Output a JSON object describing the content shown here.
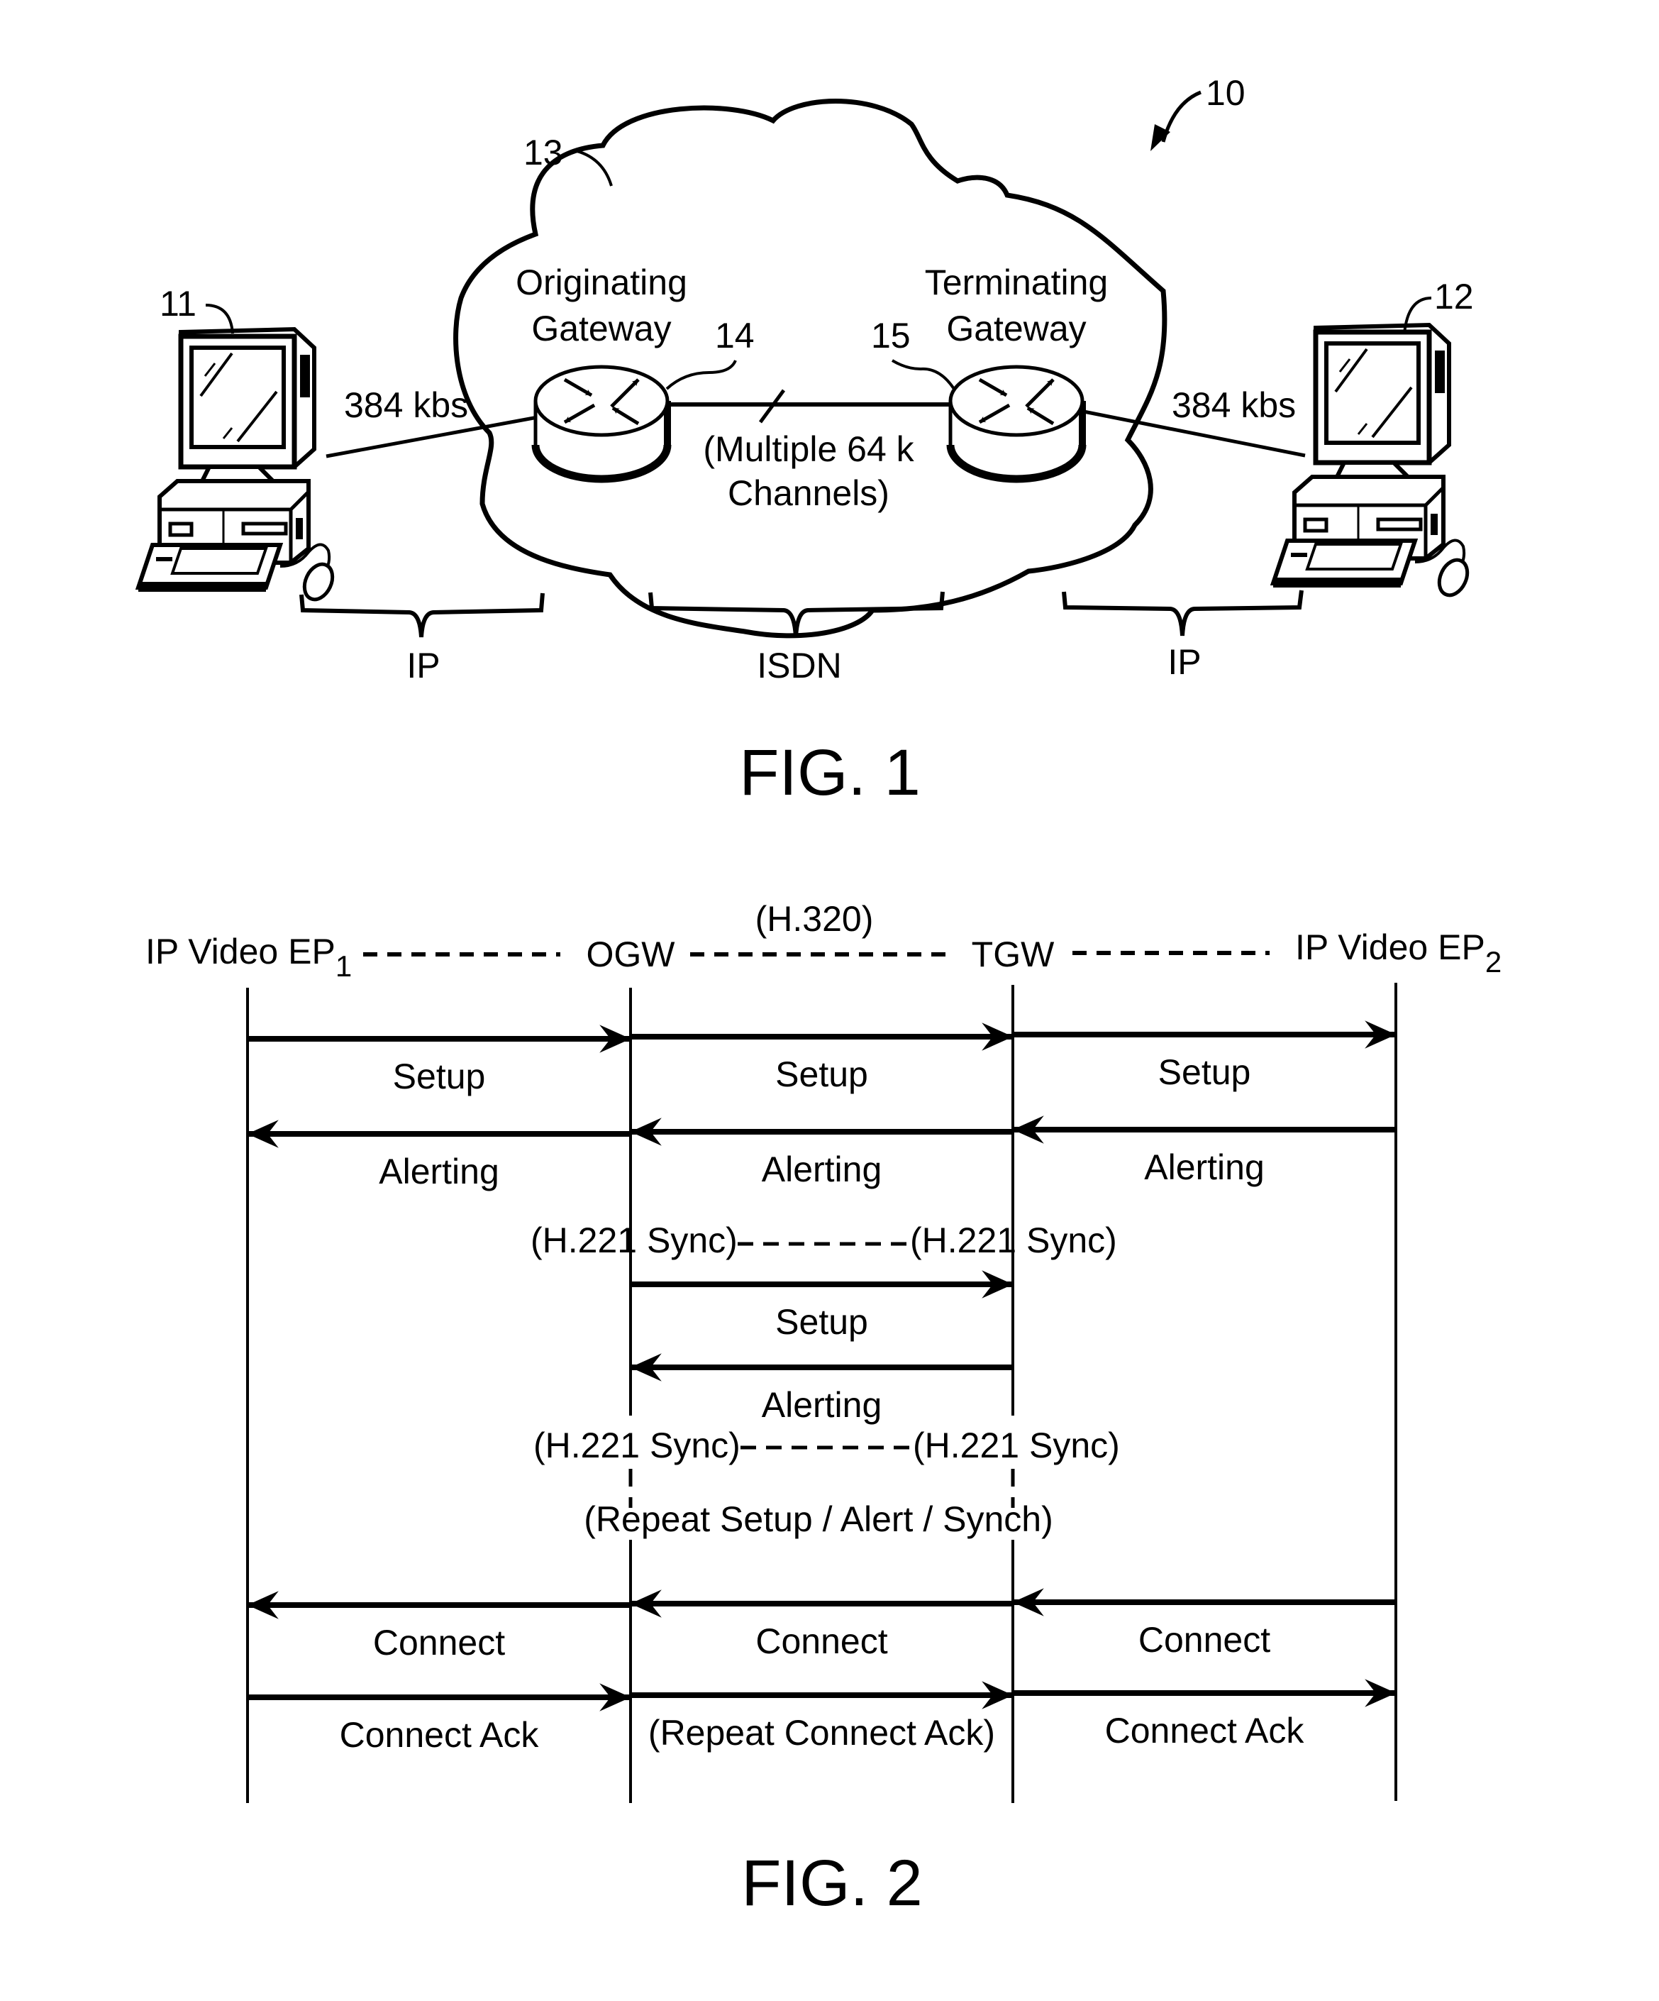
{
  "fig1": {
    "system_ref": "10",
    "cloud_ref": "13",
    "endpoint_left": {
      "ref": "11",
      "rate": "384 kbs"
    },
    "endpoint_right": {
      "ref": "12",
      "rate": "384 kbs"
    },
    "gateway_originating": {
      "line1": "Originating",
      "line2": "Gateway",
      "ref": "14"
    },
    "gateway_terminating": {
      "line1": "Terminating",
      "line2": "Gateway",
      "ref": "15"
    },
    "isdn_link": {
      "line1": "(Multiple 64 k",
      "line2": "Channels)"
    },
    "segments": [
      {
        "label": "IP"
      },
      {
        "label": "ISDN"
      },
      {
        "label": "IP"
      }
    ],
    "caption": "FIG. 1"
  },
  "fig2": {
    "protocol_label": "(H.320)",
    "participants": [
      {
        "name": "IP Video EP",
        "sub": "1"
      },
      {
        "name": "OGW",
        "sub": ""
      },
      {
        "name": "TGW",
        "sub": ""
      },
      {
        "name": "IP Video EP",
        "sub": "2"
      }
    ],
    "messages": [
      {
        "from": 0,
        "to": 1,
        "label": "Setup"
      },
      {
        "from": 1,
        "to": 2,
        "label": "Setup"
      },
      {
        "from": 2,
        "to": 3,
        "label": "Setup"
      },
      {
        "from": 1,
        "to": 0,
        "label": "Alerting"
      },
      {
        "from": 2,
        "to": 1,
        "label": "Alerting"
      },
      {
        "from": 3,
        "to": 2,
        "label": "Alerting"
      },
      {
        "from": 1,
        "to": 2,
        "label": "Setup"
      },
      {
        "from": 2,
        "to": 1,
        "label": "Alerting"
      },
      {
        "from": 1,
        "to": 0,
        "label": "Connect"
      },
      {
        "from": 2,
        "to": 1,
        "label": "Connect"
      },
      {
        "from": 3,
        "to": 2,
        "label": "Connect"
      },
      {
        "from": 0,
        "to": 1,
        "label": "Connect Ack"
      },
      {
        "from": 1,
        "to": 2,
        "label": "(Repeat Connect Ack)"
      },
      {
        "from": 2,
        "to": 3,
        "label": "Connect Ack"
      }
    ],
    "sync_label": "(H.221 Sync)",
    "repeat_note": "(Repeat Setup / Alert / Synch)",
    "caption": "FIG. 2"
  }
}
